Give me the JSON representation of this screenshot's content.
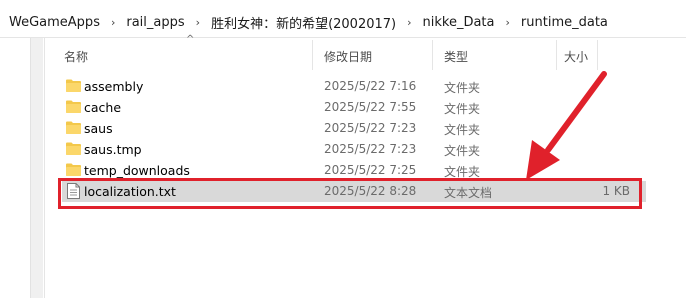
{
  "breadcrumb": [
    "WeGameApps",
    "rail_apps",
    "胜利女神：新的希望(2002017)",
    "nikke_Data",
    "runtime_data"
  ],
  "columns": {
    "name": "名称",
    "date": "修改日期",
    "type": "类型",
    "size": "大小"
  },
  "files": [
    {
      "name": "assembly",
      "date": "2025/5/22 7:16",
      "type": "文件夹",
      "size": "",
      "kind": "folder"
    },
    {
      "name": "cache",
      "date": "2025/5/22 7:55",
      "type": "文件夹",
      "size": "",
      "kind": "folder"
    },
    {
      "name": "saus",
      "date": "2025/5/22 7:23",
      "type": "文件夹",
      "size": "",
      "kind": "folder"
    },
    {
      "name": "saus.tmp",
      "date": "2025/5/22 7:23",
      "type": "文件夹",
      "size": "",
      "kind": "folder"
    },
    {
      "name": "temp_downloads",
      "date": "2025/5/22 7:25",
      "type": "文件夹",
      "size": "",
      "kind": "folder"
    },
    {
      "name": "localization.txt",
      "date": "2025/5/22 8:28",
      "type": "文本文档",
      "size": "1 KB",
      "kind": "text-file"
    }
  ],
  "colors": {
    "highlight": "#e0212b",
    "selected_row": "#d9d9d9",
    "folder": "#f3c84b"
  }
}
